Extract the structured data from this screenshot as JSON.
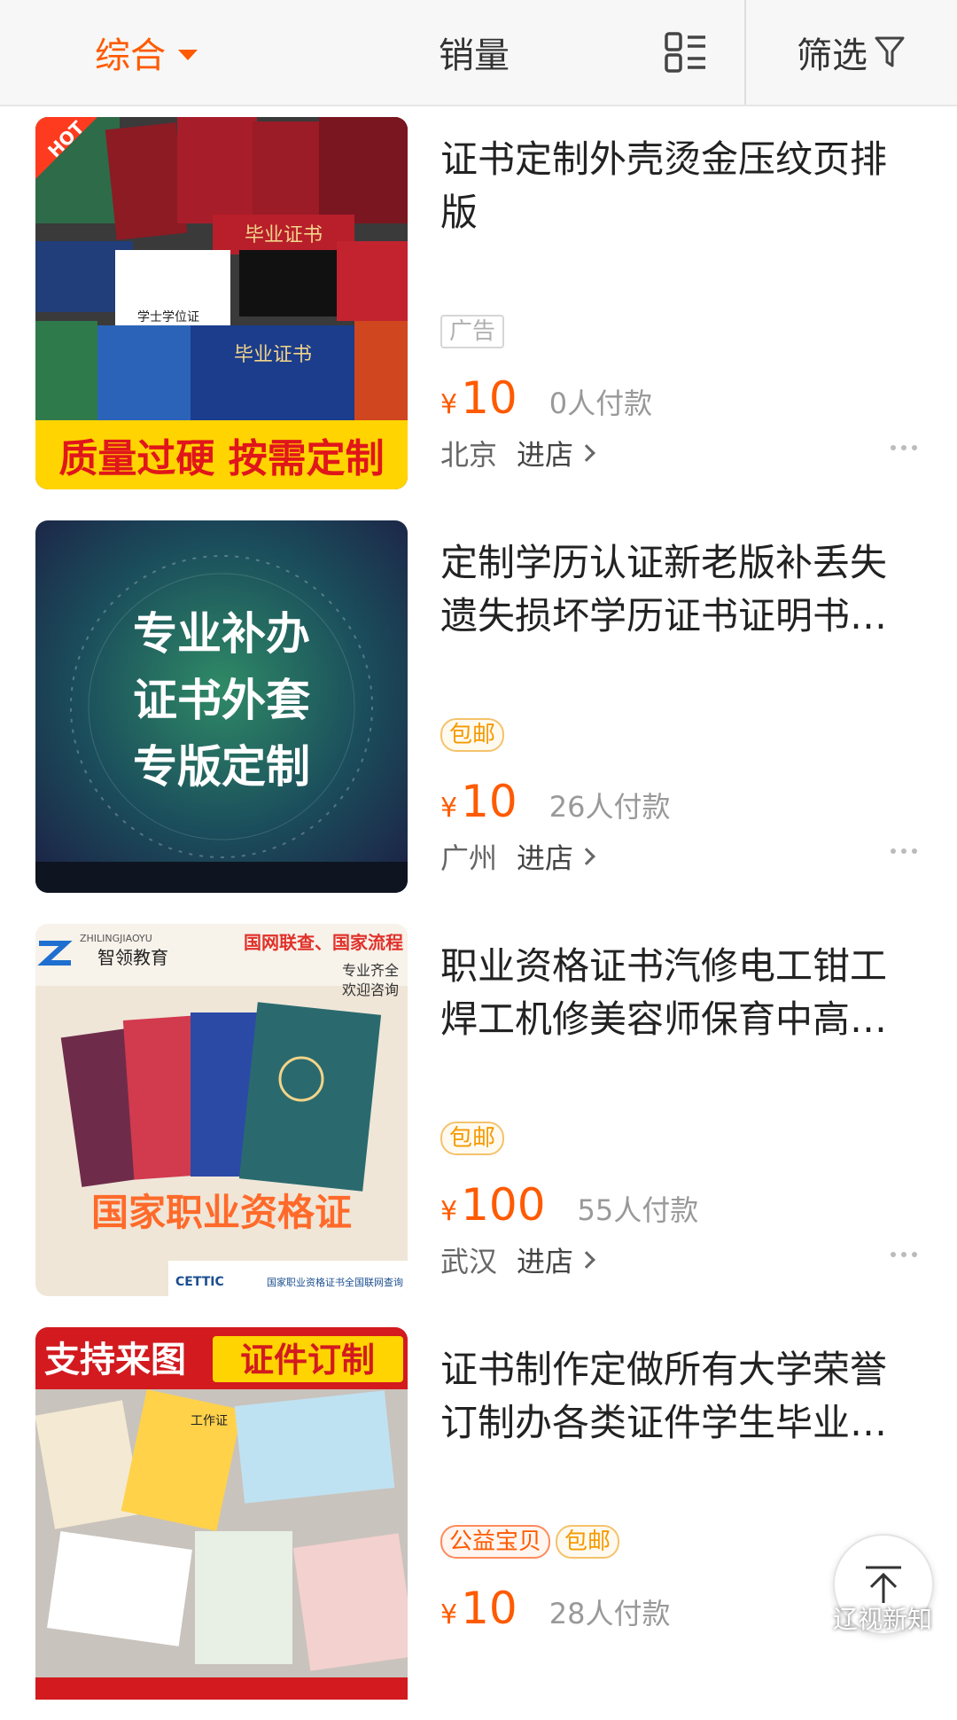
{
  "sort_bar": {
    "comprehensive": "综合",
    "sales": "销量",
    "filter": "筛选"
  },
  "items": [
    {
      "title": "证书定制外壳烫金压纹页排版",
      "tags": [
        "广告"
      ],
      "currency": "¥",
      "price": "10",
      "sold": "0人付款",
      "location": "北京",
      "enter_shop": "进店",
      "thumb": {
        "badge": "HOT",
        "caption": "质量过硬 按需定制",
        "labels": [
          "毕业证书",
          "学士学位证",
          "毕业证书"
        ]
      }
    },
    {
      "title": "定制学历认证新老版补丢失遗失损坏学历证书证明书…",
      "tags": [
        "包邮"
      ],
      "currency": "¥",
      "price": "10",
      "sold": "26人付款",
      "location": "广州",
      "enter_shop": "进店",
      "thumb": {
        "lines": [
          "专业补办",
          "证书外套",
          "专版定制"
        ]
      }
    },
    {
      "title": "职业资格证书汽修电工钳工焊工机修美容师保育中高…",
      "tags": [
        "包邮"
      ],
      "currency": "¥",
      "price": "100",
      "sold": "55人付款",
      "location": "武汉",
      "enter_shop": "进店",
      "thumb": {
        "brand_en": "ZHILINGJIAOYU",
        "brand": "智领教育",
        "headline": "国网联查、国家流程",
        "sub1": "专业齐全",
        "sub2": "欢迎咨询",
        "caption": "国家职业资格证",
        "footer_logo": "CETTIC",
        "footer": "国家职业资格证书全国联网查询"
      }
    },
    {
      "title": "证书制作定做所有大学荣誉订制办各类证件学生毕业…",
      "tags": [
        "公益宝贝",
        "包邮"
      ],
      "currency": "¥",
      "price": "10",
      "sold": "28人付款",
      "location": "",
      "enter_shop": "",
      "thumb": {
        "banner_a": "支持来图",
        "banner_b": "证件订制",
        "card_label": "工作证"
      }
    }
  ],
  "watermark": "辽视新知",
  "colors": {
    "accent": "#ff5a00",
    "tag_orange": "#f59a00"
  }
}
